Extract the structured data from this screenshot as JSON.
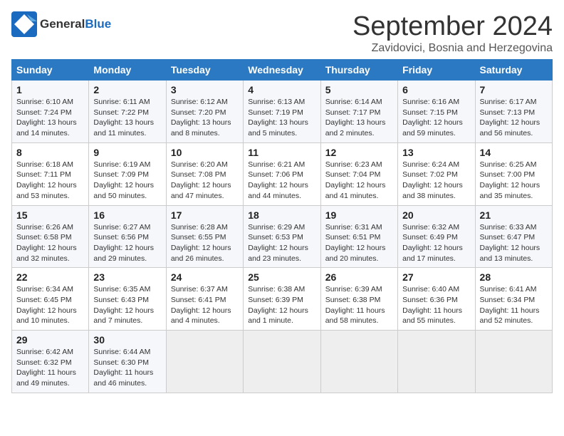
{
  "header": {
    "logo_general": "General",
    "logo_blue": "Blue",
    "month_title": "September 2024",
    "location": "Zavidovici, Bosnia and Herzegovina"
  },
  "weekdays": [
    "Sunday",
    "Monday",
    "Tuesday",
    "Wednesday",
    "Thursday",
    "Friday",
    "Saturday"
  ],
  "weeks": [
    [
      {
        "day": "1",
        "lines": [
          "Sunrise: 6:10 AM",
          "Sunset: 7:24 PM",
          "Daylight: 13 hours",
          "and 14 minutes."
        ]
      },
      {
        "day": "2",
        "lines": [
          "Sunrise: 6:11 AM",
          "Sunset: 7:22 PM",
          "Daylight: 13 hours",
          "and 11 minutes."
        ]
      },
      {
        "day": "3",
        "lines": [
          "Sunrise: 6:12 AM",
          "Sunset: 7:20 PM",
          "Daylight: 13 hours",
          "and 8 minutes."
        ]
      },
      {
        "day": "4",
        "lines": [
          "Sunrise: 6:13 AM",
          "Sunset: 7:19 PM",
          "Daylight: 13 hours",
          "and 5 minutes."
        ]
      },
      {
        "day": "5",
        "lines": [
          "Sunrise: 6:14 AM",
          "Sunset: 7:17 PM",
          "Daylight: 13 hours",
          "and 2 minutes."
        ]
      },
      {
        "day": "6",
        "lines": [
          "Sunrise: 6:16 AM",
          "Sunset: 7:15 PM",
          "Daylight: 12 hours",
          "and 59 minutes."
        ]
      },
      {
        "day": "7",
        "lines": [
          "Sunrise: 6:17 AM",
          "Sunset: 7:13 PM",
          "Daylight: 12 hours",
          "and 56 minutes."
        ]
      }
    ],
    [
      {
        "day": "8",
        "lines": [
          "Sunrise: 6:18 AM",
          "Sunset: 7:11 PM",
          "Daylight: 12 hours",
          "and 53 minutes."
        ]
      },
      {
        "day": "9",
        "lines": [
          "Sunrise: 6:19 AM",
          "Sunset: 7:09 PM",
          "Daylight: 12 hours",
          "and 50 minutes."
        ]
      },
      {
        "day": "10",
        "lines": [
          "Sunrise: 6:20 AM",
          "Sunset: 7:08 PM",
          "Daylight: 12 hours",
          "and 47 minutes."
        ]
      },
      {
        "day": "11",
        "lines": [
          "Sunrise: 6:21 AM",
          "Sunset: 7:06 PM",
          "Daylight: 12 hours",
          "and 44 minutes."
        ]
      },
      {
        "day": "12",
        "lines": [
          "Sunrise: 6:23 AM",
          "Sunset: 7:04 PM",
          "Daylight: 12 hours",
          "and 41 minutes."
        ]
      },
      {
        "day": "13",
        "lines": [
          "Sunrise: 6:24 AM",
          "Sunset: 7:02 PM",
          "Daylight: 12 hours",
          "and 38 minutes."
        ]
      },
      {
        "day": "14",
        "lines": [
          "Sunrise: 6:25 AM",
          "Sunset: 7:00 PM",
          "Daylight: 12 hours",
          "and 35 minutes."
        ]
      }
    ],
    [
      {
        "day": "15",
        "lines": [
          "Sunrise: 6:26 AM",
          "Sunset: 6:58 PM",
          "Daylight: 12 hours",
          "and 32 minutes."
        ]
      },
      {
        "day": "16",
        "lines": [
          "Sunrise: 6:27 AM",
          "Sunset: 6:56 PM",
          "Daylight: 12 hours",
          "and 29 minutes."
        ]
      },
      {
        "day": "17",
        "lines": [
          "Sunrise: 6:28 AM",
          "Sunset: 6:55 PM",
          "Daylight: 12 hours",
          "and 26 minutes."
        ]
      },
      {
        "day": "18",
        "lines": [
          "Sunrise: 6:29 AM",
          "Sunset: 6:53 PM",
          "Daylight: 12 hours",
          "and 23 minutes."
        ]
      },
      {
        "day": "19",
        "lines": [
          "Sunrise: 6:31 AM",
          "Sunset: 6:51 PM",
          "Daylight: 12 hours",
          "and 20 minutes."
        ]
      },
      {
        "day": "20",
        "lines": [
          "Sunrise: 6:32 AM",
          "Sunset: 6:49 PM",
          "Daylight: 12 hours",
          "and 17 minutes."
        ]
      },
      {
        "day": "21",
        "lines": [
          "Sunrise: 6:33 AM",
          "Sunset: 6:47 PM",
          "Daylight: 12 hours",
          "and 13 minutes."
        ]
      }
    ],
    [
      {
        "day": "22",
        "lines": [
          "Sunrise: 6:34 AM",
          "Sunset: 6:45 PM",
          "Daylight: 12 hours",
          "and 10 minutes."
        ]
      },
      {
        "day": "23",
        "lines": [
          "Sunrise: 6:35 AM",
          "Sunset: 6:43 PM",
          "Daylight: 12 hours",
          "and 7 minutes."
        ]
      },
      {
        "day": "24",
        "lines": [
          "Sunrise: 6:37 AM",
          "Sunset: 6:41 PM",
          "Daylight: 12 hours",
          "and 4 minutes."
        ]
      },
      {
        "day": "25",
        "lines": [
          "Sunrise: 6:38 AM",
          "Sunset: 6:39 PM",
          "Daylight: 12 hours",
          "and 1 minute."
        ]
      },
      {
        "day": "26",
        "lines": [
          "Sunrise: 6:39 AM",
          "Sunset: 6:38 PM",
          "Daylight: 11 hours",
          "and 58 minutes."
        ]
      },
      {
        "day": "27",
        "lines": [
          "Sunrise: 6:40 AM",
          "Sunset: 6:36 PM",
          "Daylight: 11 hours",
          "and 55 minutes."
        ]
      },
      {
        "day": "28",
        "lines": [
          "Sunrise: 6:41 AM",
          "Sunset: 6:34 PM",
          "Daylight: 11 hours",
          "and 52 minutes."
        ]
      }
    ],
    [
      {
        "day": "29",
        "lines": [
          "Sunrise: 6:42 AM",
          "Sunset: 6:32 PM",
          "Daylight: 11 hours",
          "and 49 minutes."
        ]
      },
      {
        "day": "30",
        "lines": [
          "Sunrise: 6:44 AM",
          "Sunset: 6:30 PM",
          "Daylight: 11 hours",
          "and 46 minutes."
        ]
      },
      {
        "day": "",
        "lines": []
      },
      {
        "day": "",
        "lines": []
      },
      {
        "day": "",
        "lines": []
      },
      {
        "day": "",
        "lines": []
      },
      {
        "day": "",
        "lines": []
      }
    ]
  ]
}
